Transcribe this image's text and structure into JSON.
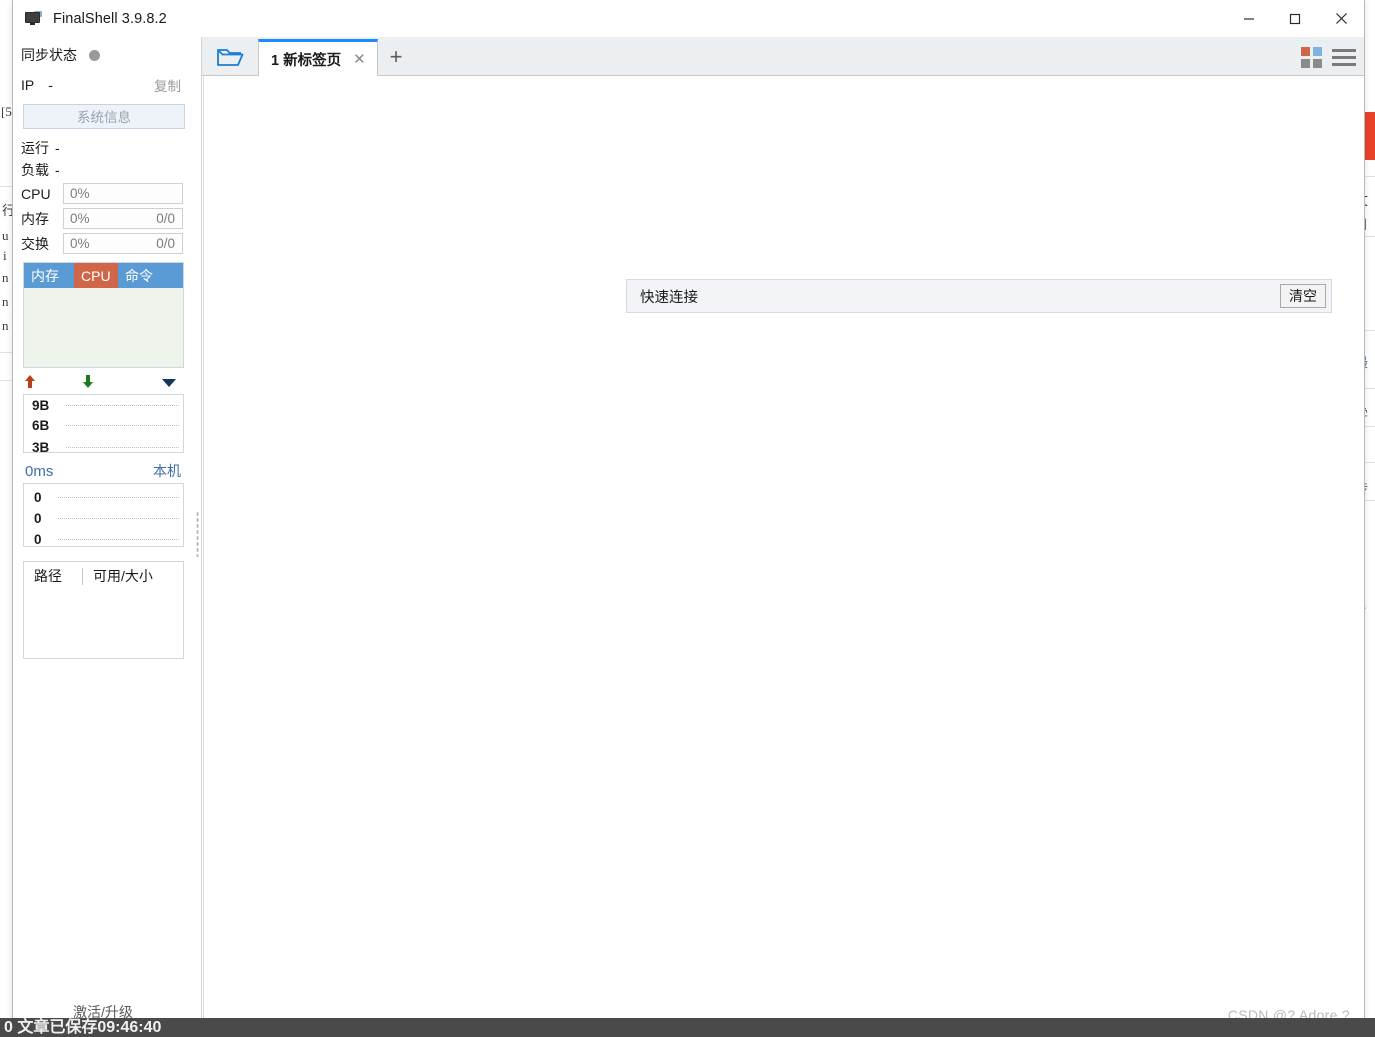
{
  "window": {
    "title": "FinalShell 3.9.8.2",
    "icon": "monitor-icon",
    "minimize_label": "—",
    "maximize_label": "□",
    "close_label": "✕"
  },
  "sidebar": {
    "sync": {
      "label": "同步状态",
      "status_icon": "status-dot",
      "status_color": "#9a9a9a"
    },
    "ip": {
      "key": "IP",
      "value": "-",
      "copy_label": "复制"
    },
    "sysinfo_button": "系统信息",
    "uptime": {
      "key": "运行",
      "value": "-"
    },
    "load": {
      "key": "负载",
      "value": "-"
    },
    "meters": [
      {
        "key": "CPU",
        "percent": "0%",
        "fraction": ""
      },
      {
        "key": "内存",
        "percent": "0%",
        "fraction": "0/0"
      },
      {
        "key": "交换",
        "percent": "0%",
        "fraction": "0/0"
      }
    ],
    "process_table": {
      "columns": [
        "内存",
        "CPU",
        "命令"
      ],
      "header_color": "#5b9bd5",
      "active_column_color": "#cf6549",
      "body_color": "#eef4ec",
      "rows": []
    },
    "network": {
      "upload_icon": "arrow-up-icon",
      "download_icon": "arrow-down-icon",
      "dropdown_icon": "chevron-down-icon",
      "upload_color": "#b5401b",
      "download_color": "#1d7a1d",
      "y_labels": [
        "9B",
        "6B",
        "3B"
      ]
    },
    "latency": {
      "value": "0ms",
      "host_label": "本机",
      "y_labels": [
        "0",
        "0",
        "0"
      ],
      "text_color": "#3e6ea8"
    },
    "disk_table": {
      "columns": [
        "路径",
        "可用/大小"
      ],
      "rows": []
    },
    "activate_label": "激活/升级"
  },
  "tabbar": {
    "folder_icon": "open-folder-icon",
    "tabs": [
      {
        "label": "1 新标签页",
        "close_icon": "close-icon",
        "active": true
      }
    ],
    "add_tab_label": "+",
    "grid_icon": "grid-view-icon",
    "menu_icon": "hamburger-menu-icon",
    "accent_color": "#1a8cff"
  },
  "main": {
    "quick_connect": {
      "label": "快速连接",
      "clear_button": "清空"
    },
    "watermark": "CSDN @? Adore ?"
  },
  "background": {
    "bottom_status": "0  文章已保存09:46:40",
    "left_fragments": [
      "[5",
      "行",
      "u",
      "i",
      "n",
      "n",
      "n"
    ],
    "right_fragments": [
      "文",
      "目",
      "最",
      "学",
      "m",
      "抟",
      "se"
    ],
    "accent_tab_color": "#e8412a"
  }
}
